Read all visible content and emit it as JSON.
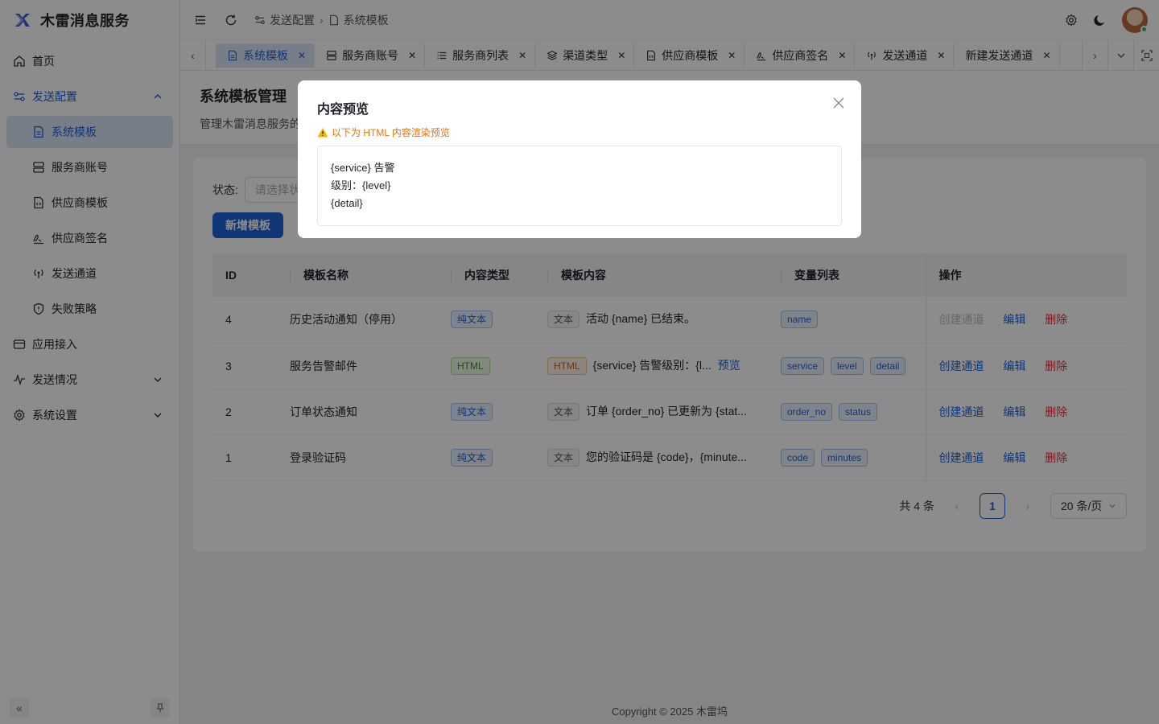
{
  "app": {
    "name": "木雷消息服务"
  },
  "sidebar": {
    "items": [
      {
        "label": "首页"
      },
      {
        "label": "发送配置"
      },
      {
        "label": "系统模板"
      },
      {
        "label": "服务商账号"
      },
      {
        "label": "供应商模板"
      },
      {
        "label": "供应商签名"
      },
      {
        "label": "发送通道"
      },
      {
        "label": "失败策略"
      },
      {
        "label": "应用接入"
      },
      {
        "label": "发送情况"
      },
      {
        "label": "系统设置"
      }
    ]
  },
  "header": {
    "breadcrumb": [
      "发送配置",
      "系统模板"
    ]
  },
  "tabs": [
    {
      "label": "系统模板"
    },
    {
      "label": "服务商账号"
    },
    {
      "label": "服务商列表"
    },
    {
      "label": "渠道类型"
    },
    {
      "label": "供应商模板"
    },
    {
      "label": "供应商签名"
    },
    {
      "label": "发送通道"
    },
    {
      "label": "新建发送通道"
    }
  ],
  "page": {
    "title": "系统模板管理",
    "description": "管理木雷消息服务的"
  },
  "filter": {
    "status_label": "状态:",
    "status_placeholder": "请选择状"
  },
  "actions": {
    "add_label": "新增模板"
  },
  "table": {
    "columns": [
      "ID",
      "模板名称",
      "内容类型",
      "模板内容",
      "变量列表",
      "操作"
    ],
    "rows": [
      {
        "id": "4",
        "name": "历史活动通知（停用）",
        "type": "纯文本",
        "content_tag": "文本",
        "content": "活动 {name} 已结束。",
        "vars": [
          "name"
        ],
        "op_create": "创建通道",
        "op_edit": "编辑",
        "op_delete": "删除"
      },
      {
        "id": "3",
        "name": "服务告警邮件",
        "type": "HTML",
        "content_tag": "HTML",
        "content": "{service} 告警级别：{l...",
        "preview": "预览",
        "vars": [
          "service",
          "level",
          "detail"
        ],
        "op_create": "创建通道",
        "op_edit": "编辑",
        "op_delete": "删除"
      },
      {
        "id": "2",
        "name": "订单状态通知",
        "type": "纯文本",
        "content_tag": "文本",
        "content": "订单 {order_no} 已更新为 {stat...",
        "vars": [
          "order_no",
          "status"
        ],
        "op_create": "创建通道",
        "op_edit": "编辑",
        "op_delete": "删除"
      },
      {
        "id": "1",
        "name": "登录验证码",
        "type": "纯文本",
        "content_tag": "文本",
        "content": "您的验证码是 {code}，{minute...",
        "vars": [
          "code",
          "minutes"
        ],
        "op_create": "创建通道",
        "op_edit": "编辑",
        "op_delete": "删除"
      }
    ]
  },
  "pagination": {
    "total": "共 4 条",
    "current": "1",
    "page_size": "20 条/页"
  },
  "footer": {
    "copyright": "Copyright © 2025 木雷坞"
  },
  "modal": {
    "title": "内容预览",
    "warning": "以下为 HTML 内容渲染预览",
    "lines": [
      "{service} 告警",
      "级别：{level}",
      "{detail}"
    ]
  },
  "colors": {
    "primary": "#1e63d6",
    "danger": "#d9363e",
    "warning": "#e8700a"
  }
}
